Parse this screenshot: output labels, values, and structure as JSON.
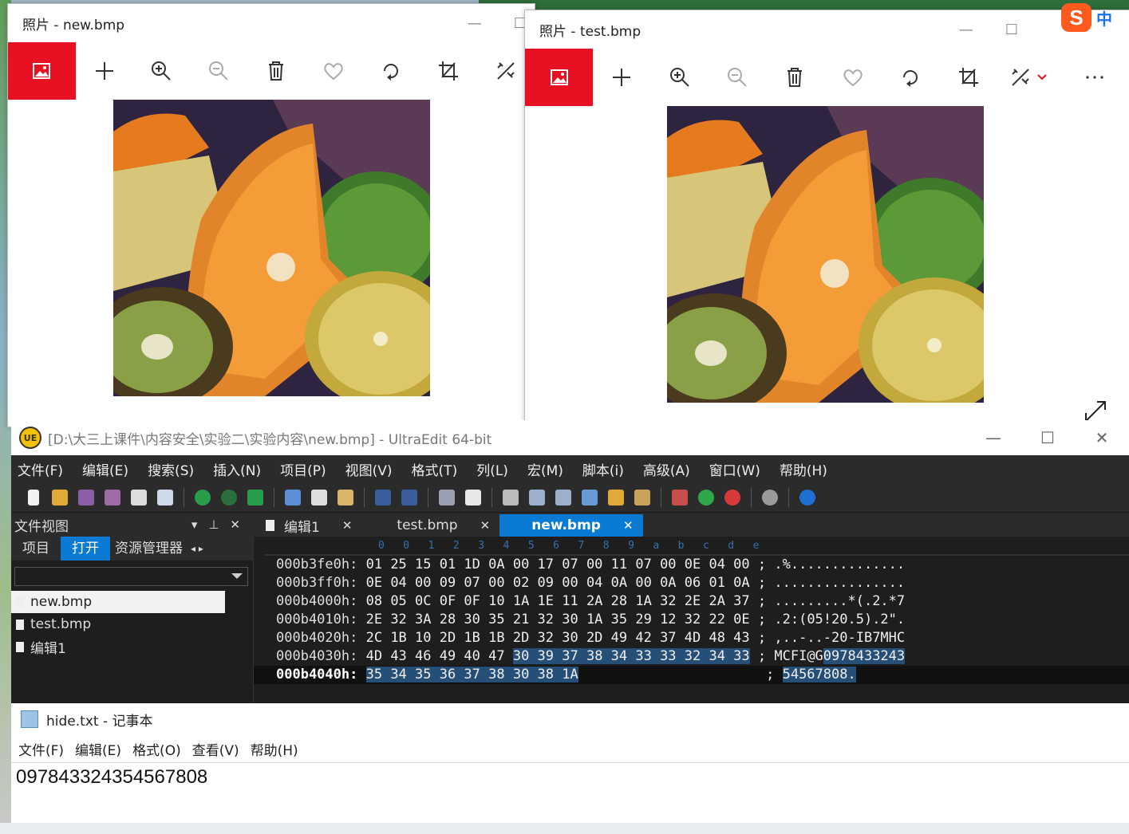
{
  "photos_left": {
    "title": "照片 - new.bmp"
  },
  "photos_right": {
    "title": "照片 - test.bmp"
  },
  "ime": {
    "label": "中"
  },
  "ultraedit": {
    "title": "[D:\\大三上课件\\内容安全\\实验二\\实验内容\\new.bmp] - UltraEdit 64-bit",
    "menu": [
      "文件(F)",
      "编辑(E)",
      "搜索(S)",
      "插入(N)",
      "项目(P)",
      "视图(V)",
      "格式(T)",
      "列(L)",
      "宏(M)",
      "脚本(i)",
      "高级(A)",
      "窗口(W)",
      "帮助(H)"
    ],
    "file_view_label": "文件视图",
    "file_view_tabs": [
      "项目",
      "打开",
      "资源管理器"
    ],
    "files": [
      "new.bmp",
      "test.bmp",
      "编辑1"
    ],
    "doc_tabs": [
      "编辑1",
      "test.bmp",
      "new.bmp"
    ],
    "ruler": "0   0   1   2   3   4   5   6   7   8   9   a   b   c   d   e",
    "rows": [
      {
        "addr": "000b3fe0h:",
        "hex": "01 25 15 01 1D 0A 00 17 07 00 11 07 00 0E 04 00",
        "ascii": ".%.............."
      },
      {
        "addr": "000b3ff0h:",
        "hex": "0E 04 00 09 07 00 02 09 00 04 0A 00 0A 06 01 0A",
        "ascii": "................"
      },
      {
        "addr": "000b4000h:",
        "hex": "08 05 0C 0F 0F 10 1A 1E 11 2A 28 1A 32 2E 2A 37",
        "ascii": ".........*(.2.*7"
      },
      {
        "addr": "000b4010h:",
        "hex": "2E 32 3A 28 30 35 21 32 30 1A 35 29 12 32 22 0E",
        "ascii": ".2:(05!20.5).2\"."
      },
      {
        "addr": "000b4020h:",
        "hex": "2C 1B 10 2D 1B 1B 2D 32 30 2D 49 42 37 4D 48 43",
        "ascii": ",..-..-20-IB7MHC"
      },
      {
        "addr": "000b4030h:",
        "hex_plain": "4D 43 46 49 40 47 ",
        "hex_hl": "30 39 37 38 34 33 33 32 34 33",
        "ascii_plain": "MCFI@G",
        "ascii_hl": "0978433243"
      },
      {
        "addr": "000b4040h:",
        "hex_hl": "35 34 35 36 37 38 30 38 1A",
        "ascii_hl": "54567808."
      }
    ]
  },
  "notepad": {
    "title": "hide.txt - 记事本",
    "menu": [
      "文件(F)",
      "编辑(E)",
      "格式(O)",
      "查看(V)",
      "帮助(H)"
    ],
    "content": "097843324354567808"
  }
}
